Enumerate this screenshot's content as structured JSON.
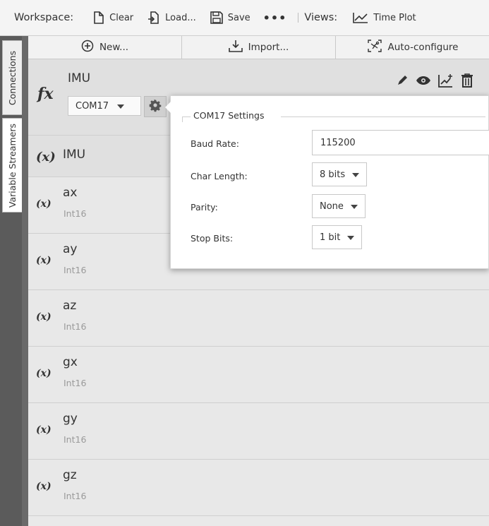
{
  "toolbar": {
    "workspace_label": "Workspace:",
    "clear_label": "Clear",
    "load_label": "Load...",
    "save_label": "Save",
    "more_label": "•••",
    "views_label": "Views:",
    "time_plot_label": "Time Plot"
  },
  "side_tabs": {
    "connections": "Connections",
    "variable_streamers": "Variable Streamers"
  },
  "actions": {
    "new_label": "New...",
    "import_label": "Import...",
    "autoconfig_label": "Auto-configure"
  },
  "stream": {
    "fx_glyph": "fx",
    "name": "IMU",
    "port": "COM17"
  },
  "variables": {
    "group": {
      "glyph": "(x)",
      "name": "IMU"
    },
    "items": [
      {
        "glyph": "(x)",
        "name": "ax",
        "type": "Int16"
      },
      {
        "glyph": "(x)",
        "name": "ay",
        "type": "Int16"
      },
      {
        "glyph": "(x)",
        "name": "az",
        "type": "Int16"
      },
      {
        "glyph": "(x)",
        "name": "gx",
        "type": "Int16"
      },
      {
        "glyph": "(x)",
        "name": "gy",
        "type": "Int16"
      },
      {
        "glyph": "(x)",
        "name": "gz",
        "type": "Int16"
      }
    ]
  },
  "settings": {
    "title": "COM17 Settings",
    "baud_label": "Baud Rate:",
    "baud_value": "115200",
    "char_label": "Char Length:",
    "char_value": "8 bits",
    "parity_label": "Parity:",
    "parity_value": "None",
    "stop_label": "Stop Bits:",
    "stop_value": "1 bit"
  },
  "icons": {
    "clear": "document-icon",
    "load": "load-icon",
    "save": "save-icon",
    "time_plot": "line-chart-icon",
    "new": "plus-circle-icon",
    "import": "download-icon",
    "autoconfig": "magic-grid-icon",
    "gear": "gear-icon",
    "edit": "pencil-icon",
    "view": "eye-icon",
    "add_plot": "chart-plus-icon",
    "delete": "trash-icon"
  },
  "colors": {
    "rail": "#5b5b5b",
    "main_bg": "#e9e9e9",
    "popup_bg": "#ffffff"
  }
}
